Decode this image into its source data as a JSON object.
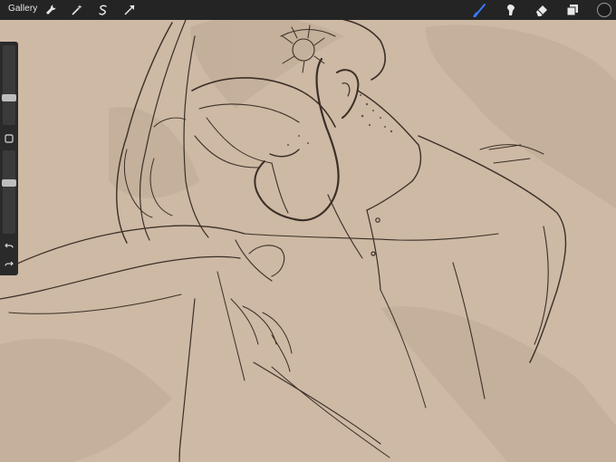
{
  "topbar": {
    "gallery_label": "Gallery",
    "left_tools": [
      "wrench-icon",
      "magic-wand-icon",
      "selection-icon",
      "transform-icon"
    ],
    "right_tools": [
      "brush-icon",
      "smudge-icon",
      "eraser-icon",
      "layers-icon",
      "color-picker-icon"
    ],
    "active_tool": "brush-icon",
    "accent_color": "#3a78ff",
    "current_color": "#1b1b1b"
  },
  "sidebar": {
    "brush_size_level": 0.32,
    "opacity_level": 0.62,
    "buttons": [
      "modify-square-icon",
      "undo-icon",
      "redo-icon"
    ]
  },
  "canvas": {
    "background_color": "#cdb9a4",
    "sketch_color": "#3b2f27"
  }
}
